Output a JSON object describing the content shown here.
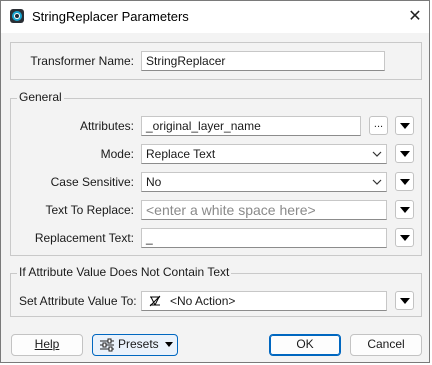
{
  "window": {
    "title": "StringReplacer Parameters",
    "close_glyph": "✕"
  },
  "transformer": {
    "label": "Transformer Name:",
    "value": "StringReplacer"
  },
  "general": {
    "legend": "General",
    "attributes": {
      "label": "Attributes:",
      "value": "_original_layer_name",
      "browse_label": "..."
    },
    "mode": {
      "label": "Mode:",
      "value": "Replace Text"
    },
    "case_sensitive": {
      "label": "Case Sensitive:",
      "value": "No"
    },
    "text_to_replace": {
      "label": "Text To Replace:",
      "placeholder": "<enter a white space here>"
    },
    "replacement_text": {
      "label": "Replacement Text:",
      "value": "_"
    }
  },
  "fallback": {
    "legend": "If Attribute Value Does Not Contain Text",
    "set_value": {
      "label": "Set Attribute Value To:",
      "value": "<No Action>",
      "icon": "no-action-icon"
    }
  },
  "buttons": {
    "help": "Help",
    "presets": "Presets",
    "ok": "OK",
    "cancel": "Cancel"
  },
  "colors": {
    "accent": "#0067c0",
    "dialog_bg": "#f3f3f3"
  }
}
